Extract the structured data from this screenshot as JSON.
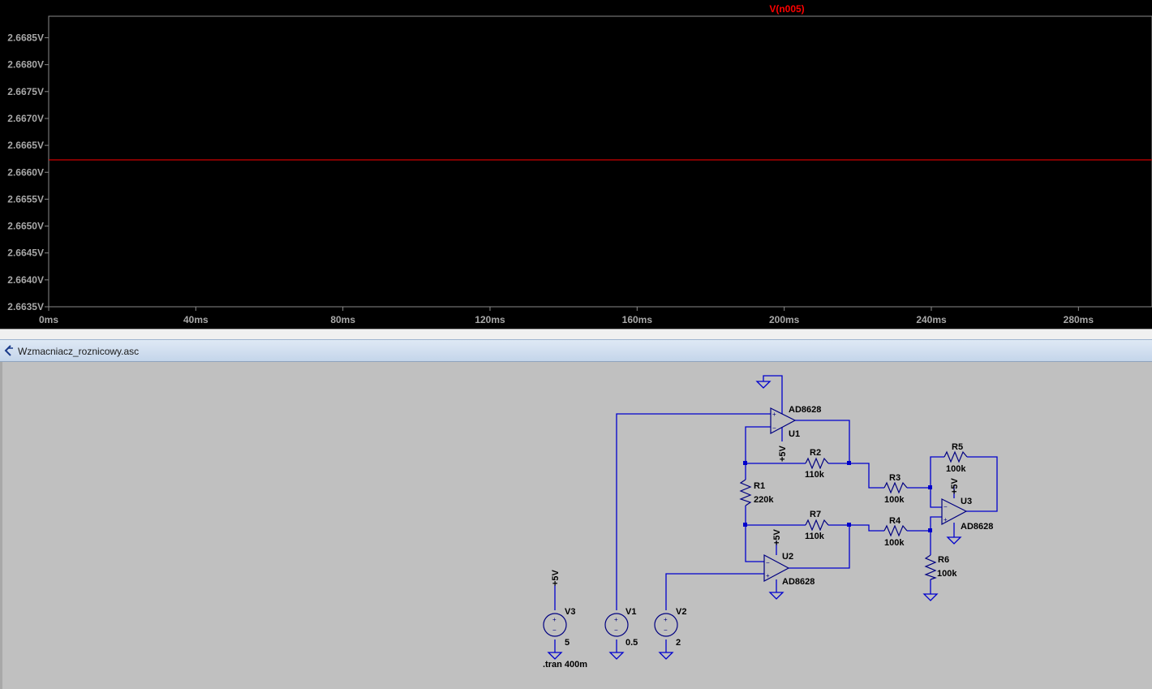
{
  "plot": {
    "trace_label": "V(n005)",
    "trace_color": "#ff0000",
    "chart_data": {
      "type": "line",
      "series": [
        {
          "name": "V(n005)",
          "x": [
            0,
            300
          ],
          "y": [
            2.66623,
            2.66623
          ]
        }
      ],
      "xlabel": "",
      "ylabel": "",
      "xlim": [
        0,
        300
      ],
      "ylim": [
        2.6635,
        2.6689
      ],
      "x_ticks": [
        0,
        40,
        80,
        120,
        160,
        200,
        240,
        280
      ],
      "x_tick_labels": [
        "0ms",
        "40ms",
        "80ms",
        "120ms",
        "160ms",
        "200ms",
        "240ms",
        "280ms"
      ],
      "y_ticks": [
        2.6635,
        2.664,
        2.6645,
        2.665,
        2.6655,
        2.666,
        2.6665,
        2.667,
        2.6675,
        2.668,
        2.6685
      ],
      "y_tick_labels": [
        "2.6635V",
        "2.6640V",
        "2.6645V",
        "2.6650V",
        "2.6655V",
        "2.6660V",
        "2.6665V",
        "2.6670V",
        "2.6675V",
        "2.6680V",
        "2.6685V"
      ],
      "grid": false,
      "background": "#000000"
    }
  },
  "schematic_window": {
    "title": "Wzmacniacz_roznicowy.asc",
    "icon": "ltspice-schematic-icon"
  },
  "schematic": {
    "wire_color": "#0000cc",
    "opamps": [
      {
        "ref": "U1",
        "model": "AD8628",
        "supply": "+5V"
      },
      {
        "ref": "U2",
        "model": "AD8628",
        "supply": "+5V"
      },
      {
        "ref": "U3",
        "model": "AD8628",
        "supply": "+5V"
      }
    ],
    "resistors": [
      {
        "ref": "R1",
        "value": "220k"
      },
      {
        "ref": "R2",
        "value": "110k"
      },
      {
        "ref": "R3",
        "value": "100k"
      },
      {
        "ref": "R4",
        "value": "100k"
      },
      {
        "ref": "R5",
        "value": "100k"
      },
      {
        "ref": "R6",
        "value": "100k"
      },
      {
        "ref": "R7",
        "value": "110k"
      }
    ],
    "sources": [
      {
        "ref": "V3",
        "value": "5",
        "net": "+5V"
      },
      {
        "ref": "V1",
        "value": "0.5"
      },
      {
        "ref": "V2",
        "value": "2"
      }
    ],
    "directive": ".tran 400m"
  }
}
